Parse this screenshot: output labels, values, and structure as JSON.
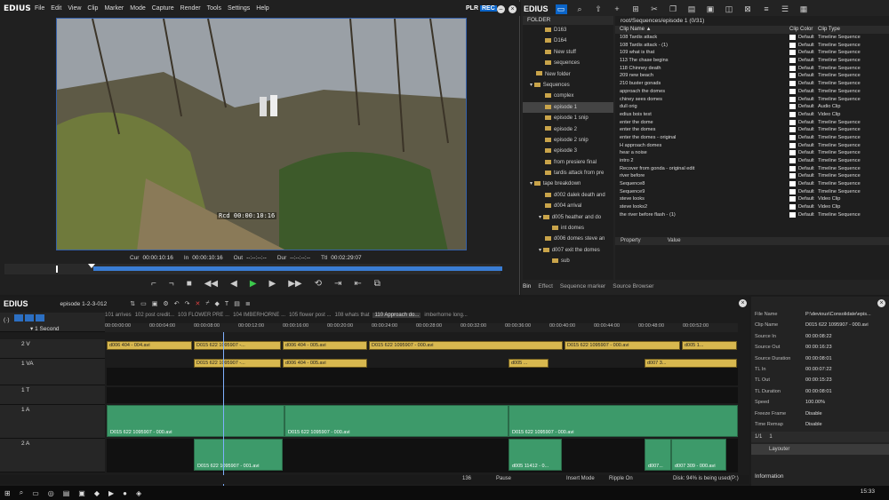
{
  "app": {
    "name": "EDIUS",
    "menu": [
      "File",
      "Edit",
      "View",
      "Clip",
      "Marker",
      "Mode",
      "Capture",
      "Render",
      "Tools",
      "Settings",
      "Help"
    ],
    "plr": "PLR",
    "rec": "REC"
  },
  "player": {
    "overlay_tc": "Rcd 00:00:10:16",
    "cur_label": "Cur",
    "cur": "00:00:10:16",
    "in_label": "In",
    "in": "00:00:10:16",
    "out_label": "Out",
    "out": "--:--:--:--",
    "dur_label": "Dur",
    "dur": "--:--:--:--",
    "ttl_label": "Ttl",
    "ttl": "00:02:29:07"
  },
  "bin": {
    "title": "EDIUS",
    "folder_header": "FOLDER",
    "path": "root/Sequences/episode 1 (0/31)",
    "folders": [
      "D163",
      "D164",
      "New stuff",
      "sequences",
      "New folder",
      "Sequences",
      "complex",
      "episode 1",
      "episode 1 snip",
      "episode 2",
      "episode 2 snip",
      "episode 3",
      "from presiere final",
      "tardis attack from pre",
      "tape breakdown",
      "d002 dalek death and",
      "d004 arrival",
      "d005 heather and do",
      "int domes",
      "d006 domes steve an",
      "d007 exit the domes",
      "sub"
    ],
    "columns": {
      "name": "Clip Name ▲",
      "color": "Clip Color",
      "type": "Clip Type"
    },
    "clips": [
      [
        "108 Tardis attack",
        "Default",
        "Timeline Sequence"
      ],
      [
        "108 Tardis attack - (1)",
        "Default",
        "Timeline Sequence"
      ],
      [
        "109 what is that",
        "Default",
        "Timeline Sequence"
      ],
      [
        "113 The chase begins",
        "Default",
        "Timeline Sequence"
      ],
      [
        "118 Chinney death",
        "Default",
        "Timeline Sequence"
      ],
      [
        "209 new beach",
        "Default",
        "Timeline Sequence"
      ],
      [
        "210 buster gonads",
        "Default",
        "Timeline Sequence"
      ],
      [
        "approach the domes",
        "Default",
        "Timeline Sequence"
      ],
      [
        "chiney sees domes",
        "Default",
        "Timeline Sequence"
      ],
      [
        "dull orig",
        "Default",
        "Audio Clip"
      ],
      [
        "edius bois test",
        "Default",
        "Video Clip"
      ],
      [
        "enter the dome",
        "Default",
        "Timeline Sequence"
      ],
      [
        "enter the domes",
        "Default",
        "Timeline Sequence"
      ],
      [
        "enter the domes - original",
        "Default",
        "Timeline Sequence"
      ],
      [
        "H approach domes",
        "Default",
        "Timeline Sequence"
      ],
      [
        "hear a noise",
        "Default",
        "Timeline Sequence"
      ],
      [
        "intro 2",
        "Default",
        "Timeline Sequence"
      ],
      [
        "Recover from gonda - original edit",
        "Default",
        "Timeline Sequence"
      ],
      [
        "river before",
        "Default",
        "Timeline Sequence"
      ],
      [
        "Sequence8",
        "Default",
        "Timeline Sequence"
      ],
      [
        "Sequence9",
        "Default",
        "Timeline Sequence"
      ],
      [
        "steve looks",
        "Default",
        "Video Clip"
      ],
      [
        "steve looks2",
        "Default",
        "Video Clip"
      ],
      [
        "the river before flash - (1)",
        "Default",
        "Timeline Sequence"
      ]
    ],
    "property_label": "Property",
    "value_label": "Value",
    "tabs": [
      "Bin",
      "Effect",
      "Sequence marker",
      "Source Browser"
    ]
  },
  "timeline": {
    "title": "EDIUS",
    "sequence": "episode 1-2-3-012",
    "zoom": "1 Second",
    "seq_tabs": [
      "101 arrives",
      "102 post credit...",
      "103 FLOWER PRE ...",
      "104 IMBERHORNE ...",
      "105 flower post ...",
      "108 whats that",
      "110 Approach do...",
      "imberhorne long..."
    ],
    "ruler": [
      "00:00:00:00",
      "00:00:04:00",
      "00:00:08:00",
      "00:00:12:00",
      "00:00:16:00",
      "00:00:20:00",
      "00:00:24:00",
      "00:00:28:00",
      "00:00:32:00",
      "00:00:36:00",
      "00:00:40:00",
      "00:00:44:00",
      "00:00:48:00",
      "00:00:52:00"
    ],
    "tracks": {
      "v2": "2 V",
      "va1": "1 VA",
      "t1": "1 T",
      "a1": "1 A",
      "a2": "2 A"
    },
    "v2_clips": [
      "d006 404 - 004.avi",
      "D015 622 1095907 -...",
      "d006 404 - 005.avi",
      "D015 622 1095907 - 000.avi",
      "D015 622 1095907 - 000.avi",
      "d005 1..."
    ],
    "va1_clips": [
      "D015 622 1095907 -...",
      "d006 404 - 005.avi",
      "d005 ...",
      "d007 3..."
    ],
    "a1_clips": [
      "D015 622 1095907 - 000.avi",
      "D015 622 1095907 - 000.avi",
      "D015 622 1095907 - 000.avi"
    ],
    "a2_clips": [
      "D015 622 1095907 - 001.avi",
      "d005 11412 - 0...",
      "d007...",
      "d007 309 - 000.avi"
    ]
  },
  "info": {
    "rows": [
      [
        "File Name",
        "P:\\devious\\Consolidate\\epis..."
      ],
      [
        "Clip Name",
        "D015 622 1095907 - 000.avi"
      ],
      [
        "Source In",
        "00:00:08:22"
      ],
      [
        "Source Out",
        "00:00:16:23"
      ],
      [
        "Source Duration",
        "00:00:08:01"
      ],
      [
        "TL In",
        "00:00:07:22"
      ],
      [
        "TL Out",
        "00:00:15:23"
      ],
      [
        "TL Duration",
        "00:00:08:01"
      ],
      [
        "Speed",
        "100.00%"
      ],
      [
        "Freeze Frame",
        "Disable"
      ],
      [
        "Time Remap",
        "Disable"
      ]
    ],
    "page": "1/1",
    "count": "1",
    "layer": "Layouter",
    "tab": "Information"
  },
  "status": {
    "frame": "136",
    "mode": "Pause",
    "insert": "Insert Mode",
    "ripple": "Ripple On",
    "disk": "Disk: 94% is being used(P:)"
  },
  "taskbar": {
    "clock": "15:33"
  }
}
